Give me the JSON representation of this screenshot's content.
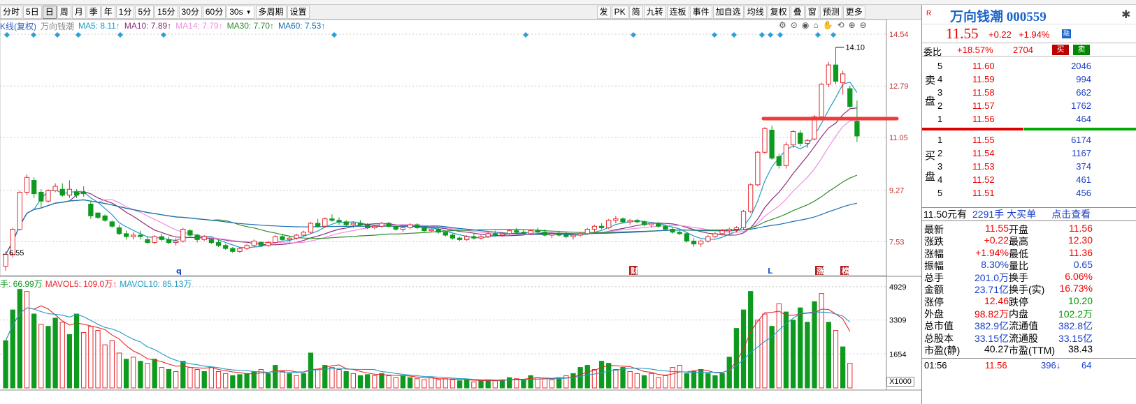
{
  "toolbar": {
    "periods": [
      "分时",
      "5日",
      "日",
      "周",
      "月",
      "季",
      "年",
      "1分",
      "5分",
      "15分",
      "30分",
      "60分"
    ],
    "active_period": "日",
    "interval_select": "30s",
    "multi_period": "多周期",
    "settings": "设置",
    "right_tools": [
      "发",
      "PK",
      "简",
      "九转",
      "连板",
      "事件",
      "加自选",
      "均线",
      "复权",
      "叠",
      "窗",
      "预测",
      "更多"
    ]
  },
  "legend": {
    "title": "K线(复权)",
    "stock": "万向钱潮",
    "ma5": "MA5: 8.11↑",
    "ma10": "MA10: 7.89↑",
    "ma14": "MA14: 7.79↑",
    "ma30": "MA30: 7.70↑",
    "ma60": "MA60: 7.53↑"
  },
  "volume_legend": {
    "vol": "手: 66.99万",
    "mavol5": "MAVOL5: 109.0万↑",
    "mavol10": "MAVOL10: 85.13万"
  },
  "price_axis": [
    "14.54",
    "12.79",
    "11.05",
    "9.27",
    "7.53"
  ],
  "volume_axis": [
    "4929",
    "3309",
    "1654"
  ],
  "volume_unit": "X1000",
  "annotations": {
    "high_label": "14.10",
    "low_label": "6.55",
    "markers": [
      "q",
      "财",
      "L",
      "涨",
      "榜"
    ]
  },
  "colors": {
    "up": "#e8262c",
    "down": "#0e9a1e",
    "ma5": "#1f9bc4",
    "ma10": "#8a2d7a",
    "ma14": "#f08ee0",
    "ma30": "#2e8b2e",
    "ma60": "#1a6fb0",
    "hline": "#f03a3a"
  },
  "chart_data": {
    "type": "candlestick",
    "ylim": [
      6.5,
      14.8
    ],
    "candles": [
      [
        6.7,
        7.2,
        6.55,
        7.1
      ],
      [
        7.1,
        8.0,
        7.0,
        7.95
      ],
      [
        7.95,
        9.25,
        7.9,
        9.2
      ],
      [
        9.2,
        9.8,
        9.1,
        9.7
      ],
      [
        9.6,
        9.7,
        9.0,
        9.15
      ],
      [
        9.2,
        9.3,
        8.7,
        8.9
      ],
      [
        8.9,
        9.3,
        8.85,
        9.25
      ],
      [
        9.25,
        9.5,
        9.2,
        9.4
      ],
      [
        9.3,
        9.5,
        9.05,
        9.1
      ],
      [
        9.1,
        9.6,
        9.0,
        9.3
      ],
      [
        9.2,
        9.3,
        9.0,
        9.1
      ],
      [
        9.2,
        9.4,
        9.05,
        9.15
      ],
      [
        8.8,
        8.9,
        8.3,
        8.4
      ],
      [
        8.5,
        8.5,
        8.3,
        8.35
      ],
      [
        8.4,
        8.45,
        8.2,
        8.25
      ],
      [
        8.2,
        8.25,
        8.0,
        8.05
      ],
      [
        8.0,
        8.1,
        7.75,
        7.8
      ],
      [
        7.8,
        7.9,
        7.6,
        7.7
      ],
      [
        7.7,
        7.85,
        7.6,
        7.75
      ],
      [
        7.75,
        7.9,
        7.6,
        7.7
      ],
      [
        7.6,
        7.7,
        7.45,
        7.5
      ],
      [
        7.5,
        7.75,
        7.45,
        7.7
      ],
      [
        7.7,
        7.8,
        7.55,
        7.6
      ],
      [
        7.6,
        7.7,
        7.45,
        7.5
      ],
      [
        7.5,
        7.65,
        7.4,
        7.55
      ],
      [
        7.55,
        8.0,
        7.5,
        7.95
      ],
      [
        7.9,
        7.95,
        7.7,
        7.75
      ],
      [
        7.75,
        7.8,
        7.5,
        7.6
      ],
      [
        7.6,
        7.75,
        7.55,
        7.7
      ],
      [
        7.6,
        7.65,
        7.45,
        7.5
      ],
      [
        7.5,
        7.6,
        7.35,
        7.4
      ],
      [
        7.4,
        7.45,
        7.25,
        7.3
      ],
      [
        7.3,
        7.35,
        7.15,
        7.2
      ],
      [
        7.2,
        7.35,
        7.15,
        7.3
      ],
      [
        7.3,
        7.45,
        7.25,
        7.4
      ],
      [
        7.4,
        7.6,
        7.35,
        7.55
      ],
      [
        7.5,
        7.55,
        7.35,
        7.4
      ],
      [
        7.4,
        7.55,
        7.35,
        7.5
      ],
      [
        7.5,
        7.75,
        7.45,
        7.7
      ],
      [
        7.7,
        7.8,
        7.55,
        7.6
      ],
      [
        7.6,
        7.7,
        7.5,
        7.65
      ],
      [
        7.65,
        7.8,
        7.6,
        7.75
      ],
      [
        7.75,
        7.9,
        7.7,
        7.85
      ],
      [
        7.85,
        8.2,
        7.8,
        8.15
      ],
      [
        8.15,
        8.3,
        8.0,
        8.05
      ],
      [
        8.05,
        8.35,
        8.0,
        8.3
      ],
      [
        8.3,
        8.45,
        8.2,
        8.25
      ],
      [
        8.25,
        8.35,
        8.1,
        8.2
      ],
      [
        8.2,
        8.25,
        8.05,
        8.1
      ],
      [
        8.1,
        8.2,
        8.0,
        8.15
      ],
      [
        8.15,
        8.25,
        8.05,
        8.1
      ],
      [
        8.1,
        8.15,
        7.95,
        8.0
      ],
      [
        8.0,
        8.1,
        7.95,
        8.05
      ],
      [
        8.05,
        8.2,
        8.0,
        8.15
      ],
      [
        8.15,
        8.2,
        8.0,
        8.05
      ],
      [
        8.05,
        8.1,
        7.9,
        7.95
      ],
      [
        7.95,
        8.05,
        7.85,
        8.0
      ],
      [
        8.0,
        8.15,
        7.95,
        8.1
      ],
      [
        8.1,
        8.15,
        7.95,
        8.0
      ],
      [
        8.0,
        8.05,
        7.85,
        7.9
      ],
      [
        7.9,
        8.0,
        7.85,
        7.95
      ],
      [
        7.95,
        8.0,
        7.8,
        7.85
      ],
      [
        7.85,
        7.9,
        7.7,
        7.75
      ],
      [
        7.75,
        7.8,
        7.6,
        7.65
      ],
      [
        7.65,
        7.7,
        7.55,
        7.6
      ],
      [
        7.6,
        7.75,
        7.55,
        7.7
      ],
      [
        7.7,
        7.8,
        7.6,
        7.65
      ],
      [
        7.65,
        7.75,
        7.6,
        7.7
      ],
      [
        7.7,
        7.85,
        7.65,
        7.8
      ],
      [
        7.8,
        7.9,
        7.7,
        7.75
      ],
      [
        7.75,
        7.85,
        7.7,
        7.8
      ],
      [
        7.8,
        7.95,
        7.75,
        7.9
      ],
      [
        7.9,
        8.0,
        7.8,
        7.85
      ],
      [
        7.85,
        7.95,
        7.75,
        7.8
      ],
      [
        7.8,
        7.95,
        7.75,
        7.9
      ],
      [
        7.9,
        8.0,
        7.8,
        7.85
      ],
      [
        7.85,
        7.95,
        7.7,
        7.75
      ],
      [
        7.75,
        7.85,
        7.65,
        7.8
      ],
      [
        7.8,
        7.9,
        7.7,
        7.75
      ],
      [
        7.75,
        7.85,
        7.65,
        7.7
      ],
      [
        7.7,
        7.8,
        7.6,
        7.75
      ],
      [
        7.75,
        7.85,
        7.7,
        7.8
      ],
      [
        7.8,
        8.0,
        7.75,
        7.95
      ],
      [
        7.95,
        8.1,
        7.85,
        8.05
      ],
      [
        8.05,
        8.15,
        7.95,
        8.0
      ],
      [
        8.0,
        8.3,
        7.95,
        8.25
      ],
      [
        8.25,
        8.4,
        8.15,
        8.3
      ],
      [
        8.3,
        8.35,
        8.15,
        8.2
      ],
      [
        8.2,
        8.3,
        8.1,
        8.25
      ],
      [
        8.25,
        8.3,
        8.15,
        8.2
      ],
      [
        8.2,
        8.25,
        8.05,
        8.1
      ],
      [
        8.1,
        8.2,
        8.0,
        8.15
      ],
      [
        8.15,
        8.2,
        8.0,
        8.05
      ],
      [
        8.05,
        8.1,
        7.9,
        7.95
      ],
      [
        7.95,
        8.0,
        7.8,
        7.85
      ],
      [
        7.85,
        7.9,
        7.75,
        7.8
      ],
      [
        7.8,
        7.85,
        7.5,
        7.55
      ],
      [
        7.55,
        7.65,
        7.35,
        7.45
      ],
      [
        7.45,
        7.6,
        7.35,
        7.55
      ],
      [
        7.55,
        7.75,
        7.5,
        7.7
      ],
      [
        7.7,
        7.85,
        7.65,
        7.8
      ],
      [
        7.8,
        7.95,
        7.75,
        7.9
      ],
      [
        7.9,
        8.0,
        7.8,
        7.95
      ],
      [
        7.95,
        8.05,
        7.85,
        8.0
      ],
      [
        8.0,
        8.6,
        7.95,
        8.55
      ],
      [
        8.55,
        9.5,
        8.5,
        9.45
      ],
      [
        9.45,
        10.6,
        9.4,
        10.55
      ],
      [
        10.55,
        11.4,
        10.5,
        11.35
      ],
      [
        11.3,
        11.45,
        10.3,
        10.35
      ],
      [
        10.4,
        10.5,
        10.0,
        10.1
      ],
      [
        10.1,
        10.9,
        10.0,
        10.8
      ],
      [
        10.8,
        11.3,
        10.7,
        11.25
      ],
      [
        11.2,
        11.3,
        10.75,
        10.85
      ],
      [
        10.85,
        11.0,
        10.7,
        10.95
      ],
      [
        11.0,
        11.8,
        10.95,
        11.75
      ],
      [
        11.75,
        12.9,
        11.7,
        12.85
      ],
      [
        12.85,
        13.6,
        12.75,
        13.5
      ],
      [
        13.5,
        14.1,
        12.85,
        12.95
      ],
      [
        12.9,
        13.3,
        12.5,
        13.2
      ],
      [
        12.7,
        12.8,
        12.05,
        12.1
      ],
      [
        11.6,
        12.3,
        10.9,
        11.1
      ]
    ],
    "volume_max": 4929,
    "volumes": [
      [
        2300,
        1
      ],
      [
        3800,
        1
      ],
      [
        4800,
        1
      ],
      [
        4700,
        0
      ],
      [
        3600,
        1
      ],
      [
        3100,
        0
      ],
      [
        3000,
        1
      ],
      [
        3400,
        1
      ],
      [
        3200,
        0
      ],
      [
        2600,
        1
      ],
      [
        3600,
        1
      ],
      [
        2700,
        0
      ],
      [
        3000,
        0
      ],
      [
        2800,
        0
      ],
      [
        2100,
        0
      ],
      [
        2300,
        0
      ],
      [
        1700,
        0
      ],
      [
        1400,
        1
      ],
      [
        1500,
        0
      ],
      [
        1300,
        1
      ],
      [
        1200,
        0
      ],
      [
        1400,
        1
      ],
      [
        1000,
        0
      ],
      [
        900,
        1
      ],
      [
        800,
        0
      ],
      [
        1300,
        1
      ],
      [
        1000,
        0
      ],
      [
        900,
        0
      ],
      [
        800,
        1
      ],
      [
        1000,
        0
      ],
      [
        800,
        0
      ],
      [
        700,
        0
      ],
      [
        600,
        1
      ],
      [
        650,
        1
      ],
      [
        700,
        1
      ],
      [
        800,
        1
      ],
      [
        900,
        0
      ],
      [
        700,
        1
      ],
      [
        1100,
        1
      ],
      [
        800,
        0
      ],
      [
        700,
        1
      ],
      [
        600,
        0
      ],
      [
        700,
        1
      ],
      [
        1700,
        1
      ],
      [
        900,
        0
      ],
      [
        1100,
        1
      ],
      [
        1000,
        0
      ],
      [
        900,
        0
      ],
      [
        800,
        1
      ],
      [
        700,
        0
      ],
      [
        600,
        1
      ],
      [
        650,
        1
      ],
      [
        600,
        0
      ],
      [
        700,
        1
      ],
      [
        600,
        0
      ],
      [
        500,
        0
      ],
      [
        600,
        1
      ],
      [
        500,
        1
      ],
      [
        450,
        0
      ],
      [
        400,
        0
      ],
      [
        500,
        0
      ],
      [
        400,
        0
      ],
      [
        450,
        0
      ],
      [
        400,
        0
      ],
      [
        350,
        1
      ],
      [
        400,
        1
      ],
      [
        300,
        0
      ],
      [
        350,
        1
      ],
      [
        400,
        1
      ],
      [
        350,
        0
      ],
      [
        400,
        1
      ],
      [
        500,
        1
      ],
      [
        450,
        0
      ],
      [
        400,
        1
      ],
      [
        600,
        1
      ],
      [
        500,
        0
      ],
      [
        450,
        0
      ],
      [
        400,
        0
      ],
      [
        500,
        1
      ],
      [
        600,
        0
      ],
      [
        700,
        1
      ],
      [
        1000,
        1
      ],
      [
        1100,
        1
      ],
      [
        900,
        0
      ],
      [
        1300,
        1
      ],
      [
        1200,
        1
      ],
      [
        900,
        0
      ],
      [
        1000,
        1
      ],
      [
        800,
        0
      ],
      [
        700,
        0
      ],
      [
        600,
        1
      ],
      [
        700,
        0
      ],
      [
        500,
        0
      ],
      [
        600,
        0
      ],
      [
        1000,
        0
      ],
      [
        1100,
        0
      ],
      [
        700,
        1
      ],
      [
        800,
        1
      ],
      [
        900,
        1
      ],
      [
        700,
        1
      ],
      [
        600,
        1
      ],
      [
        700,
        1
      ],
      [
        1500,
        1
      ],
      [
        2900,
        1
      ],
      [
        3800,
        1
      ],
      [
        4700,
        1
      ],
      [
        3300,
        0
      ],
      [
        3600,
        0
      ],
      [
        3000,
        1
      ],
      [
        4100,
        0
      ],
      [
        3700,
        1
      ],
      [
        3300,
        1
      ],
      [
        3900,
        1
      ],
      [
        3200,
        1
      ],
      [
        4200,
        1
      ],
      [
        4600,
        0
      ],
      [
        3200,
        1
      ],
      [
        2800,
        0
      ],
      [
        2000,
        1
      ],
      [
        1200,
        0
      ]
    ]
  },
  "right_panel": {
    "logo": "R",
    "name": "万向钱潮 000559",
    "price": "11.55",
    "change": "+0.22",
    "pct": "+1.94%",
    "wb_label": "委比",
    "wb_value": "+18.57%",
    "wb_num": "2704",
    "buy": "买",
    "sell": "卖",
    "sell_side": [
      "卖",
      "盘"
    ],
    "buy_side": [
      "买",
      "盘"
    ],
    "asks": [
      [
        "5",
        "11.60",
        "2046"
      ],
      [
        "4",
        "11.59",
        "994"
      ],
      [
        "3",
        "11.58",
        "662"
      ],
      [
        "2",
        "11.57",
        "1762"
      ],
      [
        "1",
        "11.56",
        "464"
      ]
    ],
    "bids": [
      [
        "1",
        "11.55",
        "6174"
      ],
      [
        "2",
        "11.54",
        "1167"
      ],
      [
        "3",
        "11.53",
        "374"
      ],
      [
        "4",
        "11.52",
        "461"
      ],
      [
        "5",
        "11.51",
        "456"
      ]
    ],
    "big_order": {
      "price": "11.50元有",
      "qty": "2291手",
      "label": "大买单",
      "link": "点击查看"
    },
    "stats": [
      [
        "最新",
        "11.55",
        "开盘",
        "11.56",
        "r",
        "r"
      ],
      [
        "涨跌",
        "+0.22",
        "最高",
        "12.30",
        "r",
        "r"
      ],
      [
        "涨幅",
        "+1.94%",
        "最低",
        "11.36",
        "r",
        "r"
      ],
      [
        "振幅",
        "8.30%",
        "量比",
        "0.65",
        "b",
        "b"
      ],
      [
        "总手",
        "201.0万",
        "换手",
        "6.06%",
        "b",
        "r"
      ],
      [
        "金额",
        "23.71亿",
        "换手(实)",
        "16.73%",
        "b",
        "r"
      ],
      [
        "涨停",
        "12.46",
        "跌停",
        "10.20",
        "r",
        "g"
      ],
      [
        "外盘",
        "98.82万",
        "内盘",
        "102.2万",
        "r",
        "g"
      ],
      [
        "总市值",
        "382.9亿",
        "流通值",
        "382.8亿",
        "b",
        "b"
      ],
      [
        "总股本",
        "33.15亿",
        "流通股",
        "33.15亿",
        "b",
        "b"
      ],
      [
        "市盈(静)",
        "40.27",
        "市盈(TTM)",
        "38.43",
        "k",
        "k"
      ]
    ],
    "tick": {
      "time": "01:56",
      "price": "11.56",
      "vol": "396",
      "extra": "64"
    }
  }
}
